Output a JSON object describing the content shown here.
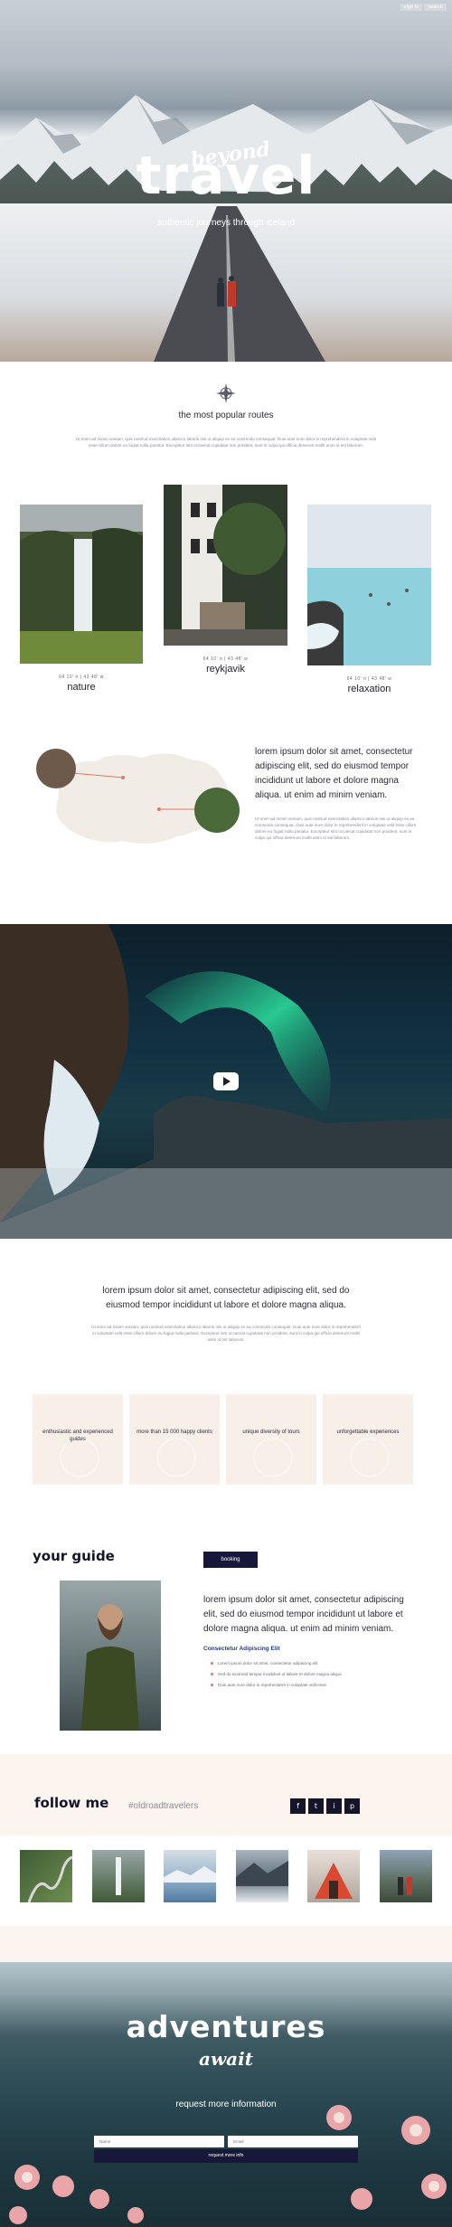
{
  "hero": {
    "links": [
      "sign in",
      "search"
    ],
    "script": "beyond",
    "title": "travel",
    "subtitle": "authentic journeys through iceland"
  },
  "routes": {
    "title": "the most popular routes",
    "text": "Ut enim ad minim veniam, quis nostrud exercitation ullamco laboris nisi ut aliquip ex ea commodo consequat. Duis aute irure dolor in reprehenderit in voluptate velit esse cillum dolore eu fugiat nulla pariatur. Excepteur sint occaecat cupidatat non proident, sunt in culpa qui officia deserunt mollit anim id est laborum.",
    "cards": [
      {
        "coords": "64 10' n | 43 48' w",
        "name": "nature"
      },
      {
        "coords": "64 10' n | 43 48' w",
        "name": "reykjavik"
      },
      {
        "coords": "64 10' n | 43 48' w",
        "name": "relaxation"
      }
    ]
  },
  "map_section": {
    "heading": "lorem ipsum dolor sit amet, consectetur adipiscing elit, sed do eiusmod tempor incididunt ut labore et dolore magna aliqua. ut enim ad minim veniam.",
    "text": "Ut enim ad minim veniam, quis nostrud exercitation ullamco laboris nisi ut aliquip ex ea commodo consequat. Duis aute irure dolor in reprehenderit in voluptate velit esse cillum dolore eu fugiat nulla pariatur. Excepteur sint occaecat cupidatat non proident, sunt in culpa qui officia deserunt mollit anim id est laborum."
  },
  "intro": {
    "heading": "lorem ipsum dolor sit amet, consectetur adipiscing elit, sed do eiusmod tempor incididunt ut labore et dolore magna aliqua.",
    "text": "Ut enim ad minim veniam, quis nostrud exercitation ullamco laboris nisi ut aliquip ex ea commodo consequat. Duis aute irure dolor in reprehenderit in voluptate velit esse cillum dolore eu fugiat nulla pariatur. Excepteur sint occaecat cupidatat non proident, sunt in culpa qui officia deserunt mollit anim id est laborum."
  },
  "features": [
    "enthusiastic and experienced guides",
    "more than 15 000 happy clients",
    "unique diversity of tours",
    "unforgettable experiences"
  ],
  "guide": {
    "title": "your guide",
    "booking": "booking",
    "heading": "lorem ipsum dolor sit amet, consectetur adipiscing elit, sed do eiusmod tempor incididunt ut labore et dolore magna aliqua. ut enim ad minim veniam.",
    "sub": "Consectetur Adipiscing Elit",
    "list": [
      "Lorem ipsum dolor sit amet, consectetur adipiscing elit",
      "Sed do eiusmod tempor incididunt ut labore et dolore magna aliqua",
      "Duis aute irure dolor in reprehenderit in voluptate velit esse"
    ]
  },
  "follow": {
    "title": "follow me",
    "tag": "#oldroadtravelers",
    "socials": [
      "f",
      "t",
      "i",
      "p"
    ]
  },
  "adventures": {
    "title": "adventures",
    "script": "await",
    "sub": "request more information",
    "name_placeholder": "Name",
    "email_placeholder": "Email",
    "send": "request more info"
  }
}
